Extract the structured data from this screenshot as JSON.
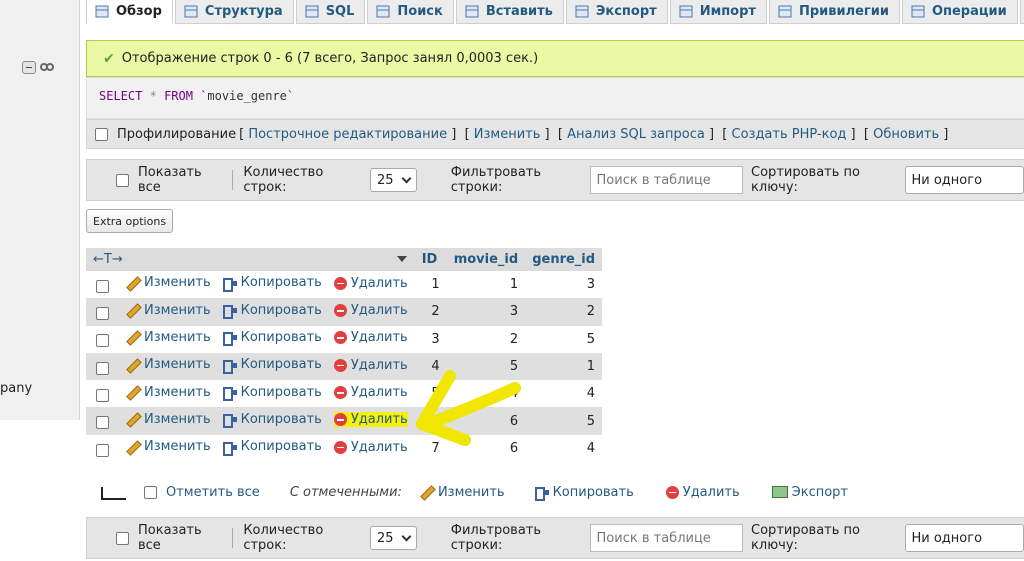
{
  "tabs": [
    {
      "label": "Обзор",
      "icon": "table-browse-icon",
      "active": true
    },
    {
      "label": "Структура",
      "icon": "structure-icon"
    },
    {
      "label": "SQL",
      "icon": "sql-icon"
    },
    {
      "label": "Поиск",
      "icon": "search-icon"
    },
    {
      "label": "Вставить",
      "icon": "insert-icon"
    },
    {
      "label": "Экспорт",
      "icon": "export-icon"
    },
    {
      "label": "Импорт",
      "icon": "import-icon"
    },
    {
      "label": "Привилегии",
      "icon": "privileges-icon"
    },
    {
      "label": "Операции",
      "icon": "operations-icon"
    },
    {
      "label": "",
      "icon": "tracking-icon"
    }
  ],
  "left": {
    "text": "pany"
  },
  "message": {
    "text": "Отображение строк 0 - 6 (7 всего, Запрос занял 0,0003 сек.)"
  },
  "sql": {
    "select": "SELECT",
    "star": "*",
    "from": "FROM",
    "table": "`movie_genre`"
  },
  "profiling": {
    "label": "Профилирование",
    "links": [
      "Построчное редактирование",
      "Изменить",
      "Анализ SQL запроса",
      "Создать PHP-код",
      "Обновить"
    ]
  },
  "nav": {
    "show_all": "Показать все",
    "rows_label": "Количество строк:",
    "rows_value": "25",
    "filter_label": "Фильтровать строки:",
    "filter_placeholder": "Поиск в таблице",
    "sort_label": "Сортировать по ключу:",
    "sort_value": "Ни одного"
  },
  "extra_options": "Extra options",
  "table": {
    "arrows": "←T→",
    "columns": [
      "ID",
      "movie_id",
      "genre_id"
    ],
    "actions": {
      "edit": "Изменить",
      "copy": "Копировать",
      "delete": "Удалить"
    },
    "rows": [
      {
        "id": "1",
        "movie_id": "1",
        "genre_id": "3"
      },
      {
        "id": "2",
        "movie_id": "3",
        "genre_id": "2"
      },
      {
        "id": "3",
        "movie_id": "2",
        "genre_id": "5"
      },
      {
        "id": "4",
        "movie_id": "5",
        "genre_id": "1"
      },
      {
        "id": "5",
        "movie_id": "4",
        "genre_id": "4"
      },
      {
        "id": "6",
        "movie_id": "6",
        "genre_id": "5"
      },
      {
        "id": "7",
        "movie_id": "6",
        "genre_id": "4"
      }
    ],
    "highlighted_row_index": 5,
    "highlight_color": "#f5f010"
  },
  "bulk": {
    "check_all": "Отметить все",
    "with_selected": "С отмеченными:",
    "edit": "Изменить",
    "copy": "Копировать",
    "delete": "Удалить",
    "export": "Экспорт"
  },
  "colors": {
    "link": "#235a81",
    "success_bg": "#ebf8a4",
    "annotation": "#f0e600"
  }
}
